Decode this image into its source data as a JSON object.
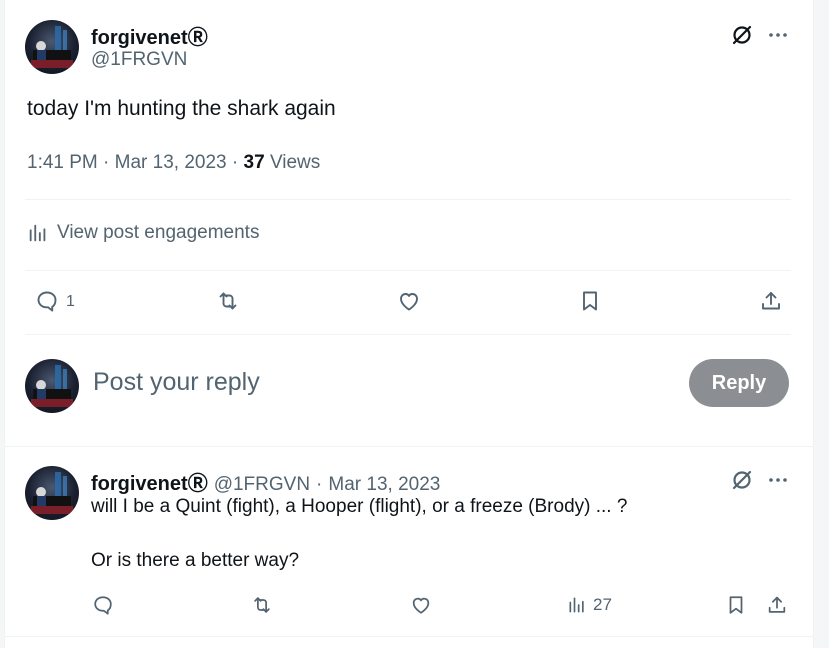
{
  "post": {
    "author_name": "forgivenet",
    "registered_mark": "Ⓡ",
    "handle": "@1FRGVN",
    "text": "today I'm hunting the shark again",
    "time": "1:41 PM",
    "date": "Mar 13, 2023",
    "views_count": "37",
    "views_label": "Views",
    "engagements_link": "View post engagements",
    "reply_count": "1"
  },
  "composer": {
    "placeholder": "Post your reply",
    "reply_button": "Reply"
  },
  "reply": {
    "author_name": "forgivenet",
    "registered_mark": "Ⓡ",
    "handle": "@1FRGVN",
    "separator": "·",
    "date": "Mar 13, 2023",
    "line1": "will I be a Quint (fight), a Hooper (flight), or a freeze (Brody) ... ?",
    "line2": "Or is there a better way?",
    "views_count": "27"
  },
  "icons": {
    "header_action": "slashed-circle-icon",
    "more": "more-icon",
    "reply": "reply-icon",
    "repost": "repost-icon",
    "like": "like-icon",
    "bookmark": "bookmark-icon",
    "share": "share-icon",
    "analytics": "analytics-icon"
  },
  "colors": {
    "text_primary": "#0f1419",
    "text_secondary": "#536471",
    "divider": "#eff3f4",
    "reply_button_bg": "#8b8f93"
  }
}
